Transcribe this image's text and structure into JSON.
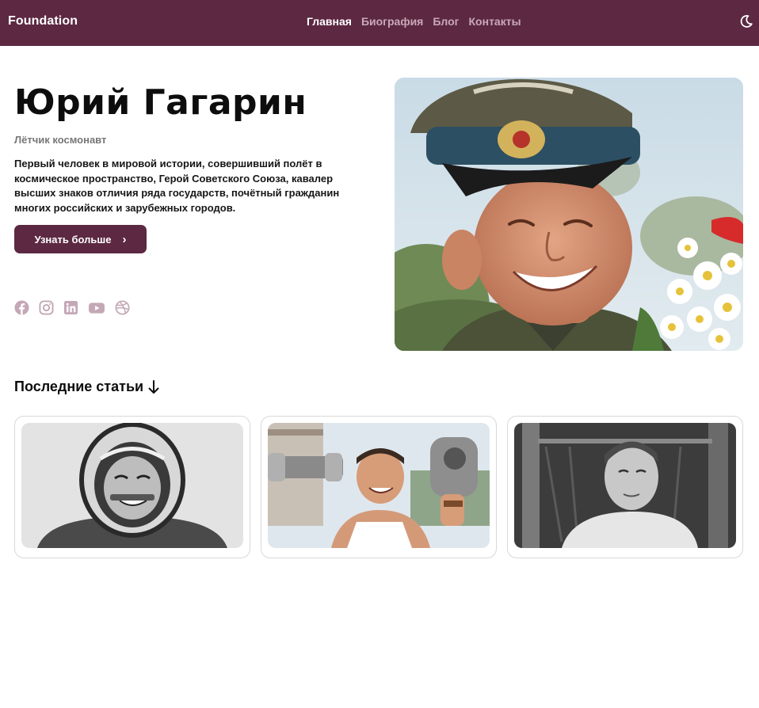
{
  "header": {
    "brand": "Foundation",
    "nav": [
      {
        "label": "Главная",
        "active": true
      },
      {
        "label": "Биография",
        "active": false
      },
      {
        "label": "Блог",
        "active": false
      },
      {
        "label": "Контакты",
        "active": false
      }
    ],
    "theme_toggle_icon": "moon-icon"
  },
  "hero": {
    "title": "Юрий Гагарин",
    "subtitle": "Лётчик космонавт",
    "description": "Первый человек в мировой истории, совершивший полёт в космическое пространство, Герой Советского Союза, кавалер высших знаков отличия ряда государств, почётный гражданин многих российских и зарубежных городов.",
    "cta_label": "Узнать больше",
    "cta_icon": "chevron-right-icon",
    "socials": [
      "facebook-icon",
      "instagram-icon",
      "linkedin-icon",
      "youtube-icon",
      "dribbble-icon"
    ],
    "photo": "portrait-photo"
  },
  "articles": {
    "title": "Последние статьи",
    "title_icon": "arrow-down-icon",
    "cards": [
      {
        "image": "cosmonaut-helmet-photo"
      },
      {
        "image": "dumbbells-photo"
      },
      {
        "image": "childhood-photo"
      }
    ]
  },
  "colors": {
    "primary": "#5c2842",
    "nav_inactive": "#c9a9b8",
    "social_icon": "#c4a8b6"
  }
}
